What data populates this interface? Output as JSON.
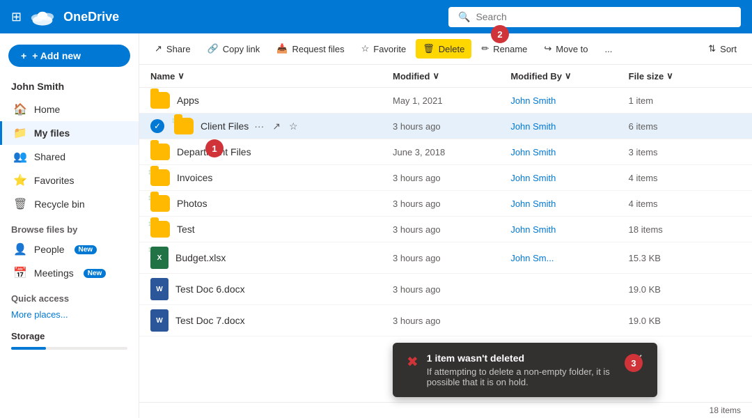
{
  "topbar": {
    "title": "OneDrive",
    "search_placeholder": "Search"
  },
  "sidebar": {
    "add_new": "+ Add new",
    "user": "John Smith",
    "nav_items": [
      {
        "id": "home",
        "label": "Home",
        "icon": "🏠"
      },
      {
        "id": "my-files",
        "label": "My files",
        "icon": "📁",
        "active": true
      },
      {
        "id": "shared",
        "label": "Shared",
        "icon": "👥"
      },
      {
        "id": "favorites",
        "label": "Favorites",
        "icon": "⭐"
      },
      {
        "id": "recycle-bin",
        "label": "Recycle bin",
        "icon": "🗑"
      }
    ],
    "browse_header": "Browse files by",
    "browse_items": [
      {
        "id": "people",
        "label": "People",
        "badge": "New"
      },
      {
        "id": "meetings",
        "label": "Meetings",
        "badge": "New"
      }
    ],
    "quick_access_header": "Quick access",
    "more_places": "More places...",
    "storage_label": "Storage"
  },
  "toolbar": {
    "share": "Share",
    "copy_link": "Copy link",
    "request_files": "Request files",
    "favorite": "Favorite",
    "delete": "Delete",
    "rename": "Rename",
    "move_to": "Move to",
    "more": "...",
    "sort": "Sort"
  },
  "file_list": {
    "columns": [
      "Name",
      "Modified",
      "Modified By",
      "File size"
    ],
    "rows": [
      {
        "id": 1,
        "type": "folder",
        "name": "Apps",
        "modified": "May 1, 2021",
        "modified_by": "John Smith",
        "size": "1 item"
      },
      {
        "id": 2,
        "type": "folder",
        "name": "Client Files",
        "modified": "3 hours ago",
        "modified_by": "John Smith",
        "size": "6 items",
        "selected": true,
        "has_sync": true
      },
      {
        "id": 3,
        "type": "folder",
        "name": "Department Files",
        "modified": "June 3, 2018",
        "modified_by": "John Smith",
        "size": "3 items"
      },
      {
        "id": 4,
        "type": "folder",
        "name": "Invoices",
        "modified": "3 hours ago",
        "modified_by": "John Smith",
        "size": "4 items",
        "has_sync": true
      },
      {
        "id": 5,
        "type": "folder",
        "name": "Photos",
        "modified": "3 hours ago",
        "modified_by": "John Smith",
        "size": "4 items",
        "has_sync": true
      },
      {
        "id": 6,
        "type": "folder",
        "name": "Test",
        "modified": "3 hours ago",
        "modified_by": "John Smith",
        "size": "18 items",
        "has_sync": true
      },
      {
        "id": 7,
        "type": "excel",
        "name": "Budget.xlsx",
        "modified": "3 hours ago",
        "modified_by": "John Sm...",
        "size": "15.3 KB",
        "has_sync": true
      },
      {
        "id": 8,
        "type": "word",
        "name": "Test Doc 6.docx",
        "modified": "3 hours ago",
        "modified_by": "",
        "size": "19.0 KB"
      },
      {
        "id": 9,
        "type": "word",
        "name": "Test Doc 7.docx",
        "modified": "3 hours ago",
        "modified_by": "",
        "size": "19.0 KB"
      }
    ]
  },
  "toast": {
    "title": "1 item wasn't deleted",
    "message": "If attempting to delete a non-empty folder, it is possible that it is on hold."
  },
  "status_bar": {
    "items_count": "18 items"
  },
  "circle_labels": {
    "c1": "1",
    "c2": "2",
    "c3": "3"
  }
}
